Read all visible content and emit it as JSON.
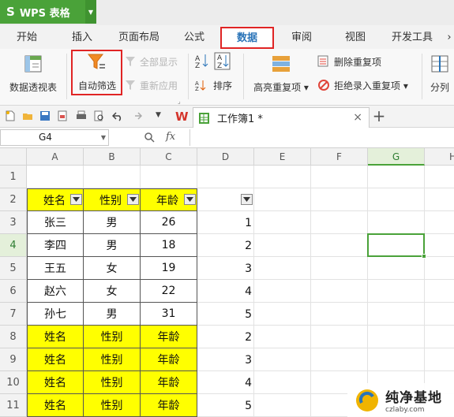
{
  "app": {
    "name": "WPS 表格",
    "logo": "S"
  },
  "menu_tabs": [
    "开始",
    "插入",
    "页面布局",
    "公式",
    "数据",
    "审阅",
    "视图",
    "开发工具"
  ],
  "active_tab": "数据",
  "ribbon": {
    "pivot": "数据透视表",
    "autofilter": "自动筛选",
    "show_all": "全部显示",
    "reapply": "重新应用",
    "sort": "排序",
    "highlight_dup": "高亮重复项",
    "remove_dup": "删除重复项",
    "reject_dup": "拒绝录入重复项",
    "split": "分列"
  },
  "doc_tab": {
    "title": "工作簿1 *",
    "close": "×",
    "new": "+"
  },
  "formula_bar": {
    "cell_ref": "G4",
    "fx": "fx",
    "value": ""
  },
  "columns": [
    "A",
    "B",
    "C",
    "D",
    "E",
    "F",
    "G",
    "H"
  ],
  "selected_column": "G",
  "rows": [
    "1",
    "2",
    "3",
    "4",
    "5",
    "6",
    "7",
    "8",
    "9",
    "10",
    "11"
  ],
  "selected_row": "4",
  "table_header": [
    "姓名",
    "性别",
    "年龄"
  ],
  "table_rows": [
    [
      "张三",
      "男",
      "26"
    ],
    [
      "李四",
      "男",
      "18"
    ],
    [
      "王五",
      "女",
      "19"
    ],
    [
      "赵六",
      "女",
      "22"
    ],
    [
      "孙七",
      "男",
      "31"
    ],
    [
      "姓名",
      "性别",
      "年龄"
    ],
    [
      "姓名",
      "性别",
      "年龄"
    ],
    [
      "姓名",
      "性别",
      "年龄"
    ],
    [
      "姓名",
      "性别",
      "年龄"
    ]
  ],
  "column_d": [
    "1",
    "2",
    "3",
    "4",
    "5",
    "2",
    "3",
    "4",
    "5"
  ],
  "watermark": {
    "brand": "纯净基地",
    "url": "czlaby.com"
  },
  "colors": {
    "accent_green": "#4aa239",
    "highlight_red": "#e02424",
    "cell_yellow": "#ffff00"
  }
}
